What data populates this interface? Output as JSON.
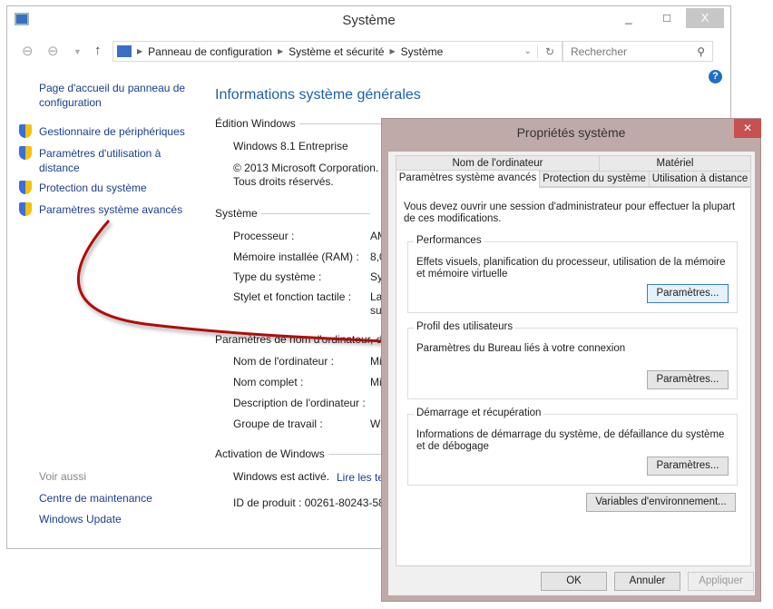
{
  "window": {
    "title": "Système",
    "minimize": "_",
    "maximize": "□",
    "close": "X",
    "breadcrumb": [
      "Panneau de configuration",
      "Système et sécurité",
      "Système"
    ],
    "search_placeholder": "Rechercher"
  },
  "sidebar": {
    "home": "Page d'accueil du panneau de configuration",
    "items": [
      {
        "label": "Gestionnaire de périphériques"
      },
      {
        "label": "Paramètres d'utilisation à distance"
      },
      {
        "label": "Protection du système"
      },
      {
        "label": "Paramètres système avancés"
      }
    ],
    "see_also": "Voir aussi",
    "links": [
      "Centre de maintenance",
      "Windows Update"
    ]
  },
  "main": {
    "heading": "Informations système générales",
    "edition": {
      "title": "Édition Windows",
      "name": "Windows 8.1 Entreprise",
      "copyright": "© 2013 Microsoft Corporation.",
      "rights": "Tous droits réservés."
    },
    "system": {
      "title": "Système",
      "rows": [
        {
          "label": "Processeur :",
          "value": "AM"
        },
        {
          "label": "Mémoire installée (RAM) :",
          "value": "8,0"
        },
        {
          "label": "Type du système :",
          "value": "Sy"
        },
        {
          "label": "Stylet et fonction tactile :",
          "value": "La",
          "value2": "su"
        }
      ]
    },
    "computer": {
      "title": "Paramètres de nom d'ordinateur, d",
      "rows": [
        {
          "label": "Nom de l'ordinateur :",
          "value": "Mi"
        },
        {
          "label": "Nom complet :",
          "value": "Mi"
        },
        {
          "label": "Description de l'ordinateur :",
          "value": ""
        },
        {
          "label": "Groupe de travail :",
          "value": "W("
        }
      ]
    },
    "activation": {
      "title": "Activation de Windows",
      "status": "Windows est activé.",
      "link": "Lire les te",
      "product_id": "ID de produit : 00261-80243-58"
    }
  },
  "dialog": {
    "title": "Propriétés système",
    "close": "✕",
    "tabs_row1": [
      "Nom de l'ordinateur",
      "Matériel"
    ],
    "tabs_row2": [
      "Paramètres système avancés",
      "Protection du système",
      "Utilisation à distance"
    ],
    "notice": "Vous devez ouvrir une session d'administrateur pour effectuer la plupart de ces modifications.",
    "groups": [
      {
        "title": "Performances",
        "desc": "Effets visuels, planification du processeur, utilisation de la mémoire et mémoire virtuelle",
        "button": "Paramètres..."
      },
      {
        "title": "Profil des utilisateurs",
        "desc": "Paramètres du Bureau liés à votre connexion",
        "button": "Paramètres..."
      },
      {
        "title": "Démarrage et récupération",
        "desc": "Informations de démarrage du système, de défaillance du système et de débogage",
        "button": "Paramètres..."
      }
    ],
    "env_button": "Variables d'environnement...",
    "ok": "OK",
    "cancel": "Annuler",
    "apply": "Appliquer"
  },
  "colors": {
    "link": "#1a3e8c",
    "heading": "#1e5fa8",
    "arrow": "#b01010",
    "dialog_frame": "#bfa9a9",
    "close": "#c75050"
  }
}
